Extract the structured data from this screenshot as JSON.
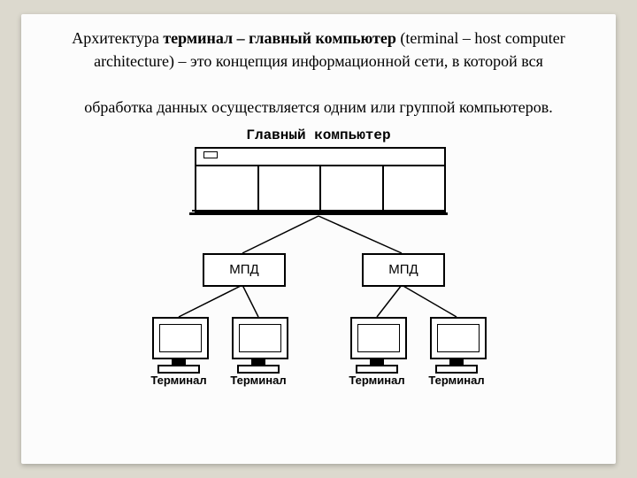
{
  "description": {
    "prefix": "Архитектура ",
    "bold": "терминал – главный компьютер",
    "middle": " (terminal – host computer architecture) – это концепция информационной сети, в которой вся",
    "line2": "обработка данных осуществляется одним или группой компьютеров."
  },
  "diagram": {
    "host_label": "Главный компьютер",
    "mpd_left": "МПД",
    "mpd_right": "МПД",
    "terminal_labels": [
      "Терминал",
      "Терминал",
      "Терминал",
      "Терминал"
    ]
  }
}
